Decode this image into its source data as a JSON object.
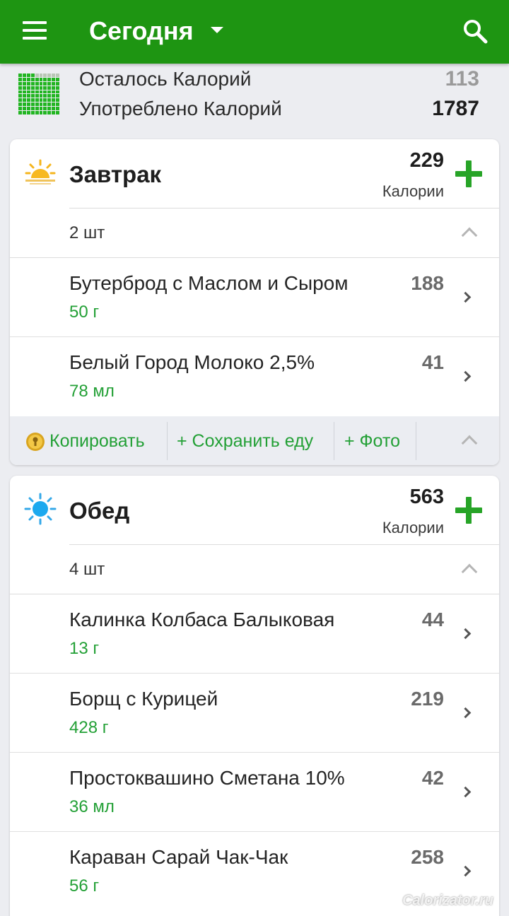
{
  "appbar": {
    "title": "Сегодня"
  },
  "summary": {
    "remaining_label": "Осталось Калорий",
    "remaining_value": "113",
    "consumed_label": "Употреблено Калорий",
    "consumed_value": "1787",
    "progress_fraction": 0.94
  },
  "meals": [
    {
      "title": "Завтрак",
      "calories": "229",
      "calories_label": "Калории",
      "count": "2 шт",
      "icon": "sunrise-icon",
      "items": [
        {
          "name": "Бутерброд с Маслом и Сыром",
          "qty": "50 г",
          "cal": "188"
        },
        {
          "name": "Белый Город Молоко 2,5%",
          "qty": "78 мл",
          "cal": "41"
        }
      ],
      "actions": {
        "copy": "Копировать",
        "save": "+ Сохранить еду",
        "photo": "+ Фото"
      }
    },
    {
      "title": "Обед",
      "calories": "563",
      "calories_label": "Калории",
      "count": "4 шт",
      "icon": "sun-icon",
      "items": [
        {
          "name": "Калинка Колбаса Балыковая",
          "qty": "13 г",
          "cal": "44"
        },
        {
          "name": "Борщ с Курицей",
          "qty": "428 г",
          "cal": "219"
        },
        {
          "name": "Простоквашино Сметана 10%",
          "qty": "36 мл",
          "cal": "42"
        },
        {
          "name": "Караван Сарай Чак-Чак",
          "qty": "56 г",
          "cal": "258"
        }
      ]
    }
  ],
  "watermark": "Calorizator.ru",
  "colors": {
    "brand_green": "#1e9512",
    "accent_green": "#23a036",
    "background": "#ecedf1"
  }
}
